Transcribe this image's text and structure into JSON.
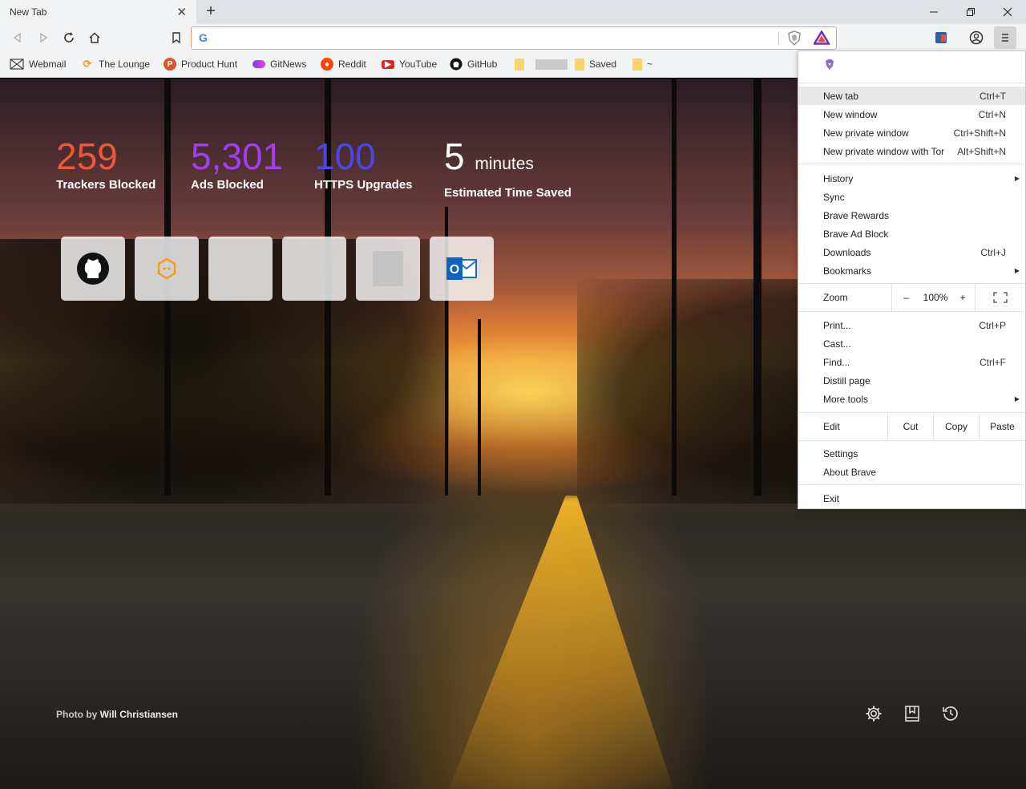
{
  "tab": {
    "title": "New Tab",
    "close": "✕",
    "new_tab": "+"
  },
  "window": {
    "minimize": "–",
    "close": "✕"
  },
  "omnibox": {
    "value": ""
  },
  "bookmarks": [
    {
      "label": "Webmail",
      "icon": "webmail-icon"
    },
    {
      "label": "The Lounge",
      "icon": "lounge-icon"
    },
    {
      "label": "Product Hunt",
      "icon": "product-hunt-icon"
    },
    {
      "label": "GitNews",
      "icon": "gitnews-icon"
    },
    {
      "label": "Reddit",
      "icon": "reddit-icon"
    },
    {
      "label": "YouTube",
      "icon": "youtube-icon"
    },
    {
      "label": "GitHub",
      "icon": "github-icon"
    },
    {
      "label": "",
      "icon": "folder-icon"
    },
    {
      "label": "Saved",
      "icon": "folder-icon"
    },
    {
      "label": "~",
      "icon": "folder-icon"
    }
  ],
  "stats": {
    "trackers": {
      "value": "259",
      "label": "Trackers Blocked",
      "color": "#f0573a"
    },
    "ads": {
      "value": "5,301",
      "label": "Ads Blocked",
      "color": "#a23df2"
    },
    "https": {
      "value": "100",
      "label": "HTTPS Upgrades",
      "color": "#4a46e8"
    },
    "time": {
      "value": "5",
      "unit": "minutes",
      "label": "Estimated Time Saved",
      "color": "#ffffff"
    }
  },
  "tiles": [
    "github-icon",
    "brave-hex-icon",
    "blank",
    "blank",
    "gray-square",
    "outlook-icon"
  ],
  "outlook_letter": "O",
  "photo_credit": {
    "prefix": "Photo by",
    "author": "Will Christiansen"
  },
  "menu": {
    "items": [
      {
        "label": "New tab",
        "shortcut": "Ctrl+T"
      },
      {
        "label": "New window",
        "shortcut": "Ctrl+N"
      },
      {
        "label": "New private window",
        "shortcut": "Ctrl+Shift+N"
      },
      {
        "label": "New private window with Tor",
        "shortcut": "Alt+Shift+N"
      },
      {
        "label": "History",
        "shortcut": ""
      },
      {
        "label": "Sync",
        "shortcut": ""
      },
      {
        "label": "Brave Rewards",
        "shortcut": ""
      },
      {
        "label": "Brave Ad Block",
        "shortcut": ""
      },
      {
        "label": "Downloads",
        "shortcut": "Ctrl+J"
      },
      {
        "label": "Bookmarks",
        "shortcut": ""
      },
      {
        "label": "Print...",
        "shortcut": "Ctrl+P"
      },
      {
        "label": "Cast...",
        "shortcut": ""
      },
      {
        "label": "Find...",
        "shortcut": "Ctrl+F"
      },
      {
        "label": "Distill page",
        "shortcut": ""
      },
      {
        "label": "More tools",
        "shortcut": ""
      },
      {
        "label": "Settings",
        "shortcut": ""
      },
      {
        "label": "About Brave",
        "shortcut": ""
      },
      {
        "label": "Exit",
        "shortcut": ""
      }
    ],
    "zoom": {
      "label": "Zoom",
      "minus": "–",
      "value": "100%",
      "plus": "+"
    },
    "edit": {
      "label": "Edit",
      "cut": "Cut",
      "copy": "Copy",
      "paste": "Paste"
    }
  },
  "colors": {
    "accent_orange": "#f0a07a",
    "menu_highlight": "#e8e8e8"
  }
}
